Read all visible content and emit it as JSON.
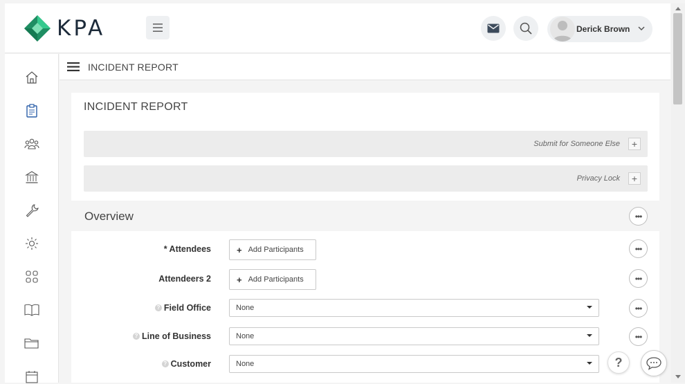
{
  "brand": {
    "name": "KPA",
    "accent": "#2bb58a"
  },
  "header": {
    "user_name": "Derick Brown",
    "icons": [
      "hamburger-icon",
      "mail-icon",
      "search-icon",
      "chevron-down-icon"
    ]
  },
  "nav": {
    "items": [
      "home-icon",
      "clipboard-icon",
      "users-icon",
      "bank-icon",
      "wrench-icon",
      "sun-icon",
      "grid-icon",
      "book-icon",
      "folder-icon",
      "calendar-icon"
    ]
  },
  "breadcrumb": {
    "title": "INCIDENT REPORT"
  },
  "form": {
    "title": "INCIDENT REPORT",
    "submit_for_someone_else": "Submit for Someone Else",
    "privacy_lock": "Privacy Lock",
    "plus": "+",
    "section_overview": "Overview",
    "fields": [
      {
        "label": "* Attendees",
        "button": "Add Participants"
      },
      {
        "label": "Attendeers 2",
        "button": "Add Participants"
      },
      {
        "label": "Field Office",
        "value": "None"
      },
      {
        "label": "Line of Business",
        "value": "None"
      },
      {
        "label": "Customer",
        "value": "None"
      }
    ],
    "more": "•••"
  },
  "floating": {
    "help": "?"
  }
}
